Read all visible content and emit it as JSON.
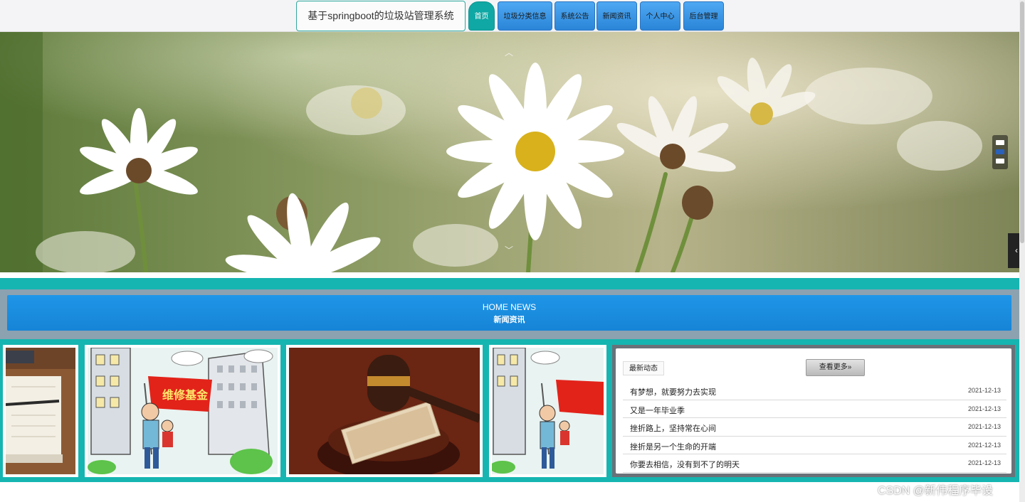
{
  "header": {
    "site_title": "基于springboot的垃圾站管理系统",
    "nav": [
      {
        "label": "首页",
        "active": true
      },
      {
        "label": "垃圾分类信息"
      },
      {
        "label": "系统公告"
      },
      {
        "label": "新闻资讯"
      },
      {
        "label": "个人中心"
      },
      {
        "label": "后台管理"
      }
    ]
  },
  "banner": {
    "slides_total": 3,
    "active_slide": 2,
    "up_icon": "chevron-up-icon",
    "down_icon": "chevron-down-icon",
    "side_icon": "chevron-left-icon"
  },
  "news": {
    "title_en": "HOME NEWS",
    "title_cn": "新闻资讯",
    "latest_label": "最新动态",
    "more_label": "查看更多»",
    "items": [
      {
        "title": "有梦想，就要努力去实现",
        "date": "2021-12-13"
      },
      {
        "title": "又是一年毕业季",
        "date": "2021-12-13"
      },
      {
        "title": "挫折路上，坚持常在心间",
        "date": "2021-12-13"
      },
      {
        "title": "挫折是另一个生命的开端",
        "date": "2021-12-13"
      },
      {
        "title": "你要去相信，没有到不了的明天",
        "date": "2021-12-13"
      }
    ],
    "thumbnail_banner_text": "维修基金"
  },
  "watermark": "CSDN @新伟程序毕设",
  "colors": {
    "accent_teal": "#16b5b1",
    "nav_blue": "#2b85d8",
    "header_blue": "#1f96e8"
  }
}
